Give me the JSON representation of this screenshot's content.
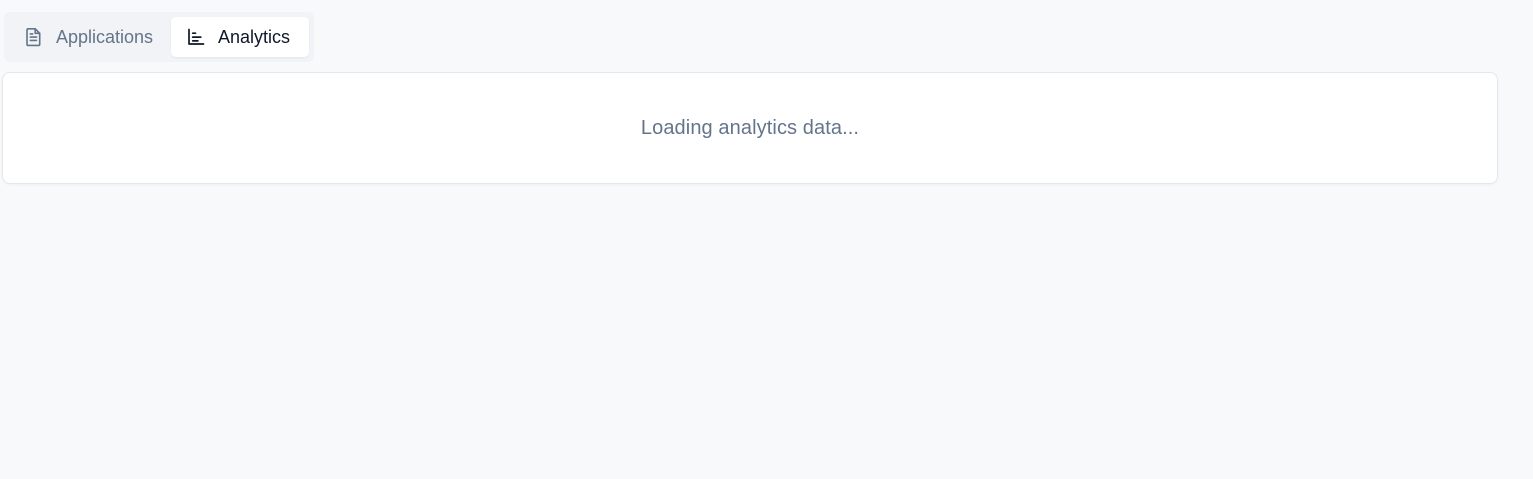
{
  "tabs": {
    "applications": {
      "label": "Applications",
      "icon": "document-icon",
      "active": false
    },
    "analytics": {
      "label": "Analytics",
      "icon": "bar-chart-icon",
      "active": true
    }
  },
  "content": {
    "loading_message": "Loading analytics data..."
  },
  "colors": {
    "background": "#f8f9fb",
    "tab_bar": "#f1f3f6",
    "active_tab": "#ffffff",
    "muted_text": "#64748b",
    "strong_text": "#0f172a"
  }
}
